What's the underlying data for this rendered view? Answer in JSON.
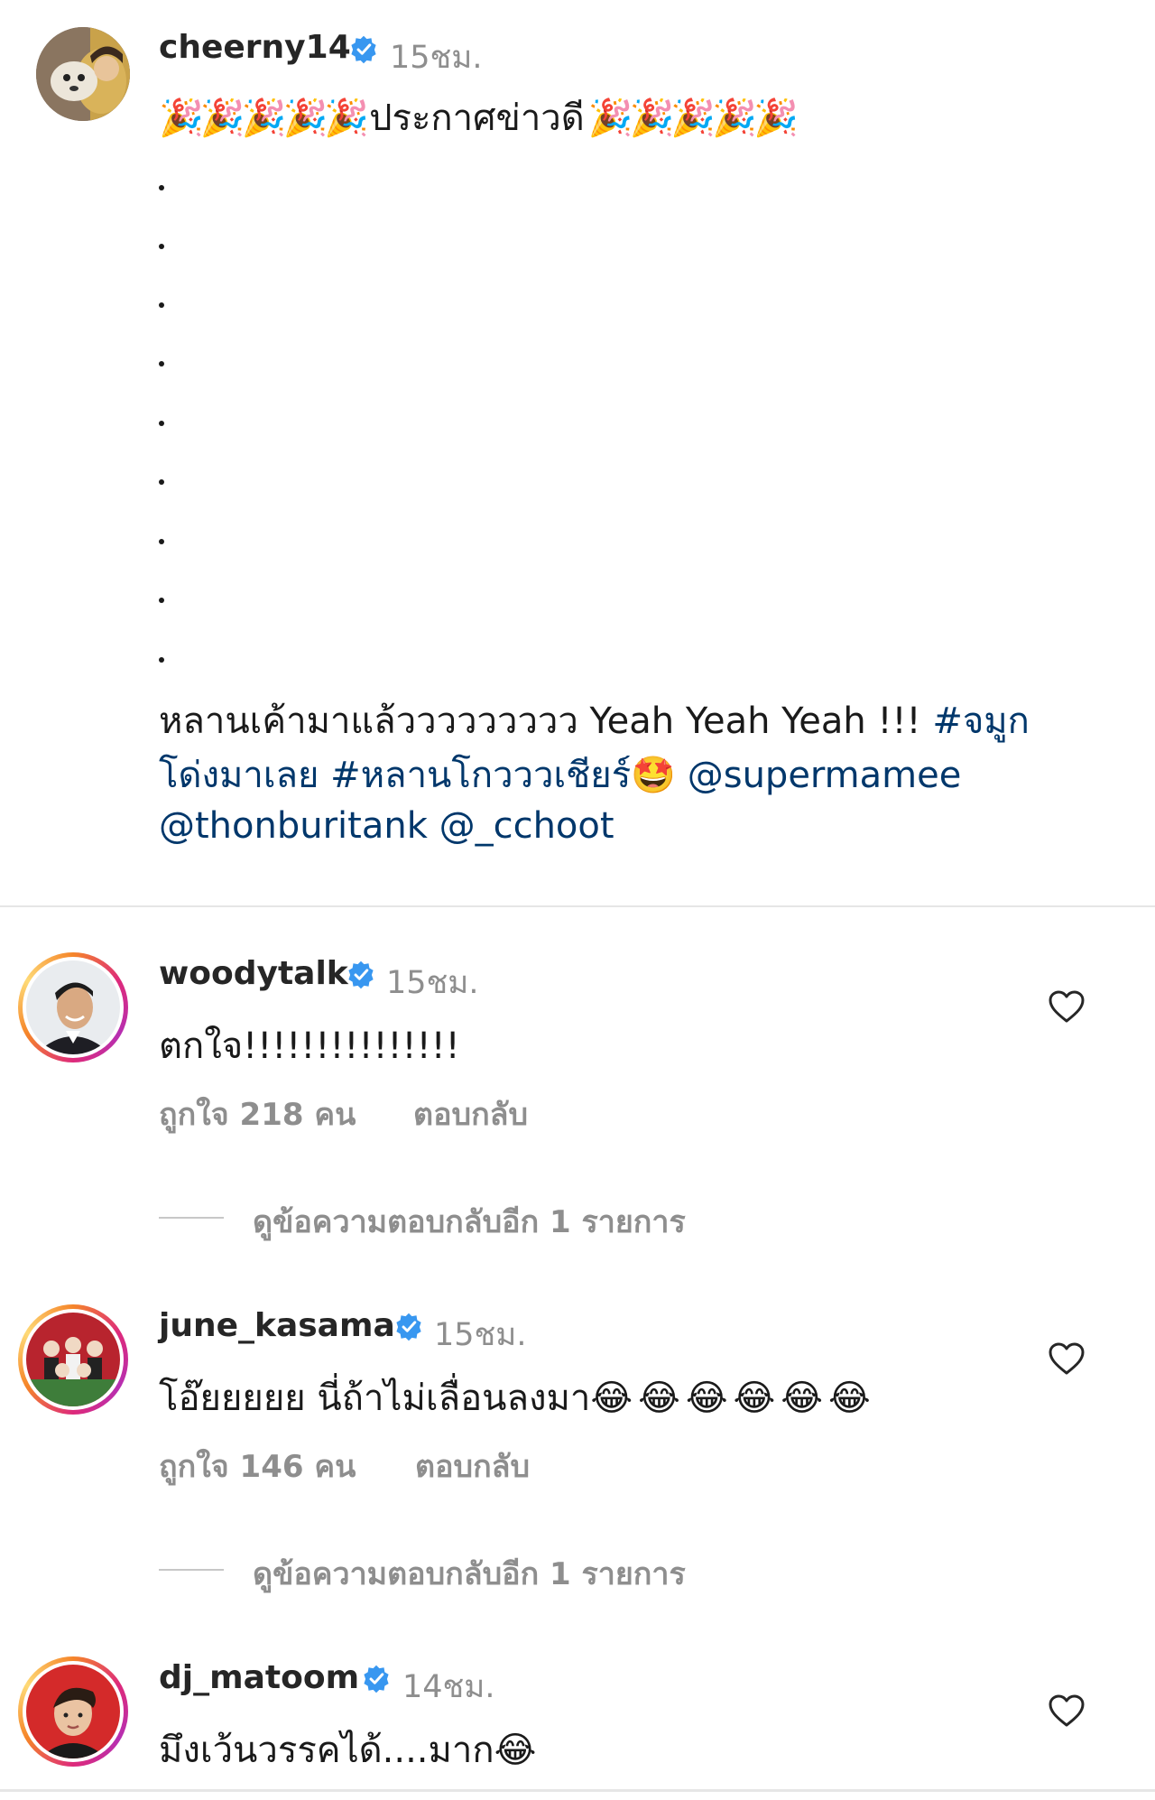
{
  "caption": {
    "username": "cheerny14",
    "time": "15ชม.",
    "headline_text": "ประกาศข่าวดี",
    "party_emoji": "🎉",
    "main_text": "หลานเค้ามาแล้ววววววววว Yeah Yeah Yeah !!!",
    "hashtag1": "#จมูก",
    "hashtag1_cont": "โด่งมาเลย",
    "hashtag2": "#หลานโกวววเชียร์",
    "star_emoji": "🤩",
    "mention1": "@supermamee",
    "mention2": "@thonburitank",
    "mention3": "@_cchoot"
  },
  "comments": [
    {
      "username": "woodytalk",
      "time": "15ชม.",
      "text": "ตกใจ!!!!!!!!!!!!!!!",
      "likes": "ถูกใจ 218 คน",
      "reply": "ตอบกลับ",
      "view_replies": "ดูข้อความตอบกลับอีก 1 รายการ"
    },
    {
      "username": "june_kasama",
      "time": "15ชม.",
      "text": "โอ๊ยยยยย นี่ถ้าไม่เลื่อนลงมา",
      "emoji": "😂😂😂😂😂😂",
      "likes": "ถูกใจ 146 คน",
      "reply": "ตอบกลับ",
      "view_replies": "ดูข้อความตอบกลับอีก 1 รายการ"
    },
    {
      "username": "dj_matoom",
      "time": "14ชม.",
      "text": "มึงเว้นวรรคได้....มาก",
      "emoji": "😂"
    }
  ],
  "colors": {
    "verified": "#3897f0",
    "link": "#00376b",
    "muted": "#8e8e8e"
  }
}
